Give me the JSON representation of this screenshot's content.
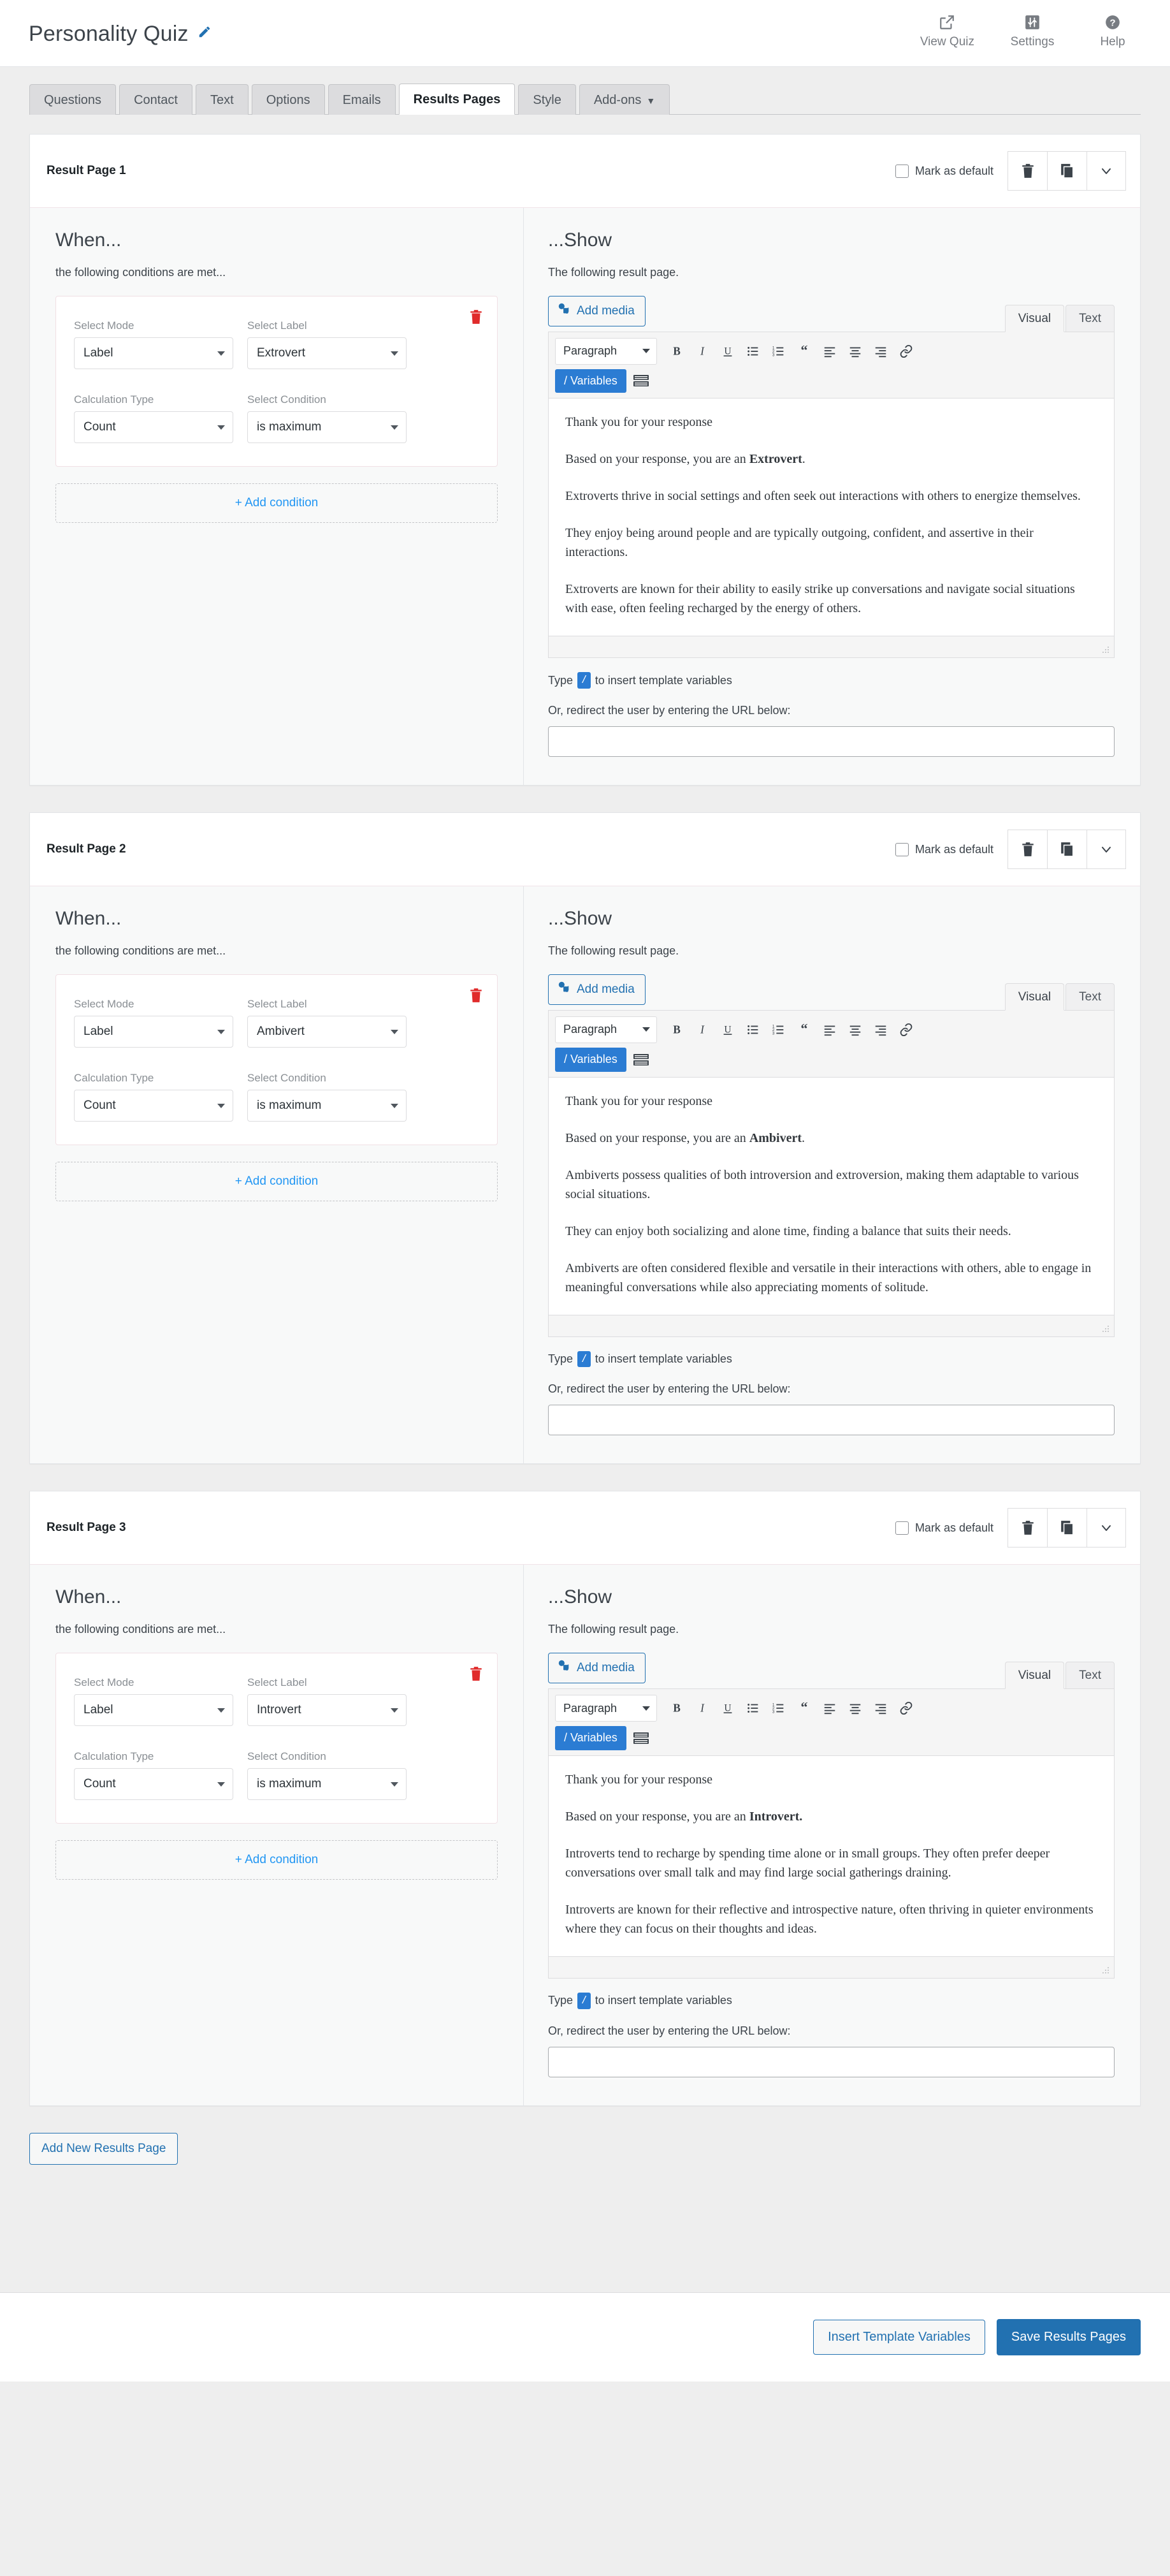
{
  "header": {
    "title": "Personality Quiz",
    "edit_icon": "pencil-icon",
    "actions": [
      {
        "label": "View Quiz",
        "icon": "external-link-icon"
      },
      {
        "label": "Settings",
        "icon": "sliders-icon"
      },
      {
        "label": "Help",
        "icon": "question-circle-icon"
      }
    ]
  },
  "tabs": [
    {
      "label": "Questions",
      "active": false
    },
    {
      "label": "Contact",
      "active": false
    },
    {
      "label": "Text",
      "active": false
    },
    {
      "label": "Options",
      "active": false
    },
    {
      "label": "Emails",
      "active": false
    },
    {
      "label": "Results Pages",
      "active": true
    },
    {
      "label": "Style",
      "active": false
    },
    {
      "label": "Add-ons",
      "active": false,
      "caret": "▼"
    }
  ],
  "common": {
    "mark_as_default": "Mark as default",
    "when_title": "When...",
    "when_sub": "the following conditions are met...",
    "show_title": "...Show",
    "show_sub": "The following result page.",
    "label_select_mode": "Select Mode",
    "label_select_label": "Select Label",
    "label_calculation_type": "Calculation Type",
    "label_select_condition": "Select Condition",
    "add_condition": "+ Add condition",
    "add_media": "Add media",
    "tab_visual": "Visual",
    "tab_text": "Text",
    "paragraph": "Paragraph",
    "variables_button": "/ Variables",
    "hint_prefix": "Type",
    "hint_key": "/",
    "hint_suffix": "to insert template variables",
    "redirect_label": "Or, redirect the user by entering the URL below:",
    "url_value": "",
    "url_placeholder": "",
    "delete_icon": "trash-icon",
    "duplicate_icon": "copy-icon",
    "collapse_icon": "chevron-down-icon",
    "delete_condition_icon": "trash-red-icon",
    "toolbar_icons": [
      "bold-icon",
      "italic-icon",
      "underline-icon",
      "bulleted-list-icon",
      "numbered-list-icon",
      "blockquote-icon",
      "align-left-icon",
      "align-center-icon",
      "align-right-icon",
      "link-icon"
    ],
    "keyboard_icon": "keyboard-icon",
    "resize_icon": "resize-grip-icon"
  },
  "pages": [
    {
      "title": "Result Page 1",
      "mark_default_checked": false,
      "condition": {
        "mode": "Label",
        "label": "Extrovert",
        "calculation": "Count",
        "condition": "is maximum"
      },
      "content": [
        {
          "text": "Thank you for your response"
        },
        {
          "pre": "Based on your response, you are an ",
          "bold": "Extrovert",
          "post": "."
        },
        {
          "text": "Extroverts thrive in social settings and often seek out interactions with others to energize themselves."
        },
        {
          "text": "They enjoy being around people and are typically outgoing, confident, and assertive in their interactions."
        },
        {
          "text": "Extroverts are known for their ability to easily strike up conversations and navigate social situations with ease, often feeling recharged by the energy of others."
        }
      ]
    },
    {
      "title": "Result Page 2",
      "mark_default_checked": false,
      "condition": {
        "mode": "Label",
        "label": "Ambivert",
        "calculation": "Count",
        "condition": "is maximum"
      },
      "content": [
        {
          "text": "Thank you for your response"
        },
        {
          "pre": "Based on your response, you are an ",
          "bold": "Ambivert",
          "post": "."
        },
        {
          "text": "Ambiverts possess qualities of both introversion and extroversion, making them adaptable to various social situations."
        },
        {
          "text": "They can enjoy both socializing and alone time, finding a balance that suits their needs."
        },
        {
          "text": "Ambiverts are often considered flexible and versatile in their interactions with others, able to engage in meaningful conversations while also appreciating moments of solitude."
        }
      ]
    },
    {
      "title": "Result Page 3",
      "mark_default_checked": false,
      "condition": {
        "mode": "Label",
        "label": "Introvert",
        "calculation": "Count",
        "condition": "is maximum"
      },
      "content": [
        {
          "text": "Thank you for your response"
        },
        {
          "pre": "Based on your response, you are an ",
          "bold": "Introvert.",
          "post": ""
        },
        {
          "text": "Introverts tend to recharge by spending time alone or in small groups. They often prefer deeper conversations over small talk and may find large social gatherings draining."
        },
        {
          "text": "Introverts are known for their reflective and introspective nature, often thriving in quieter environments where they can focus on their thoughts and ideas."
        }
      ]
    }
  ],
  "footer": {
    "add_new_results_page": "Add New Results Page",
    "insert_template_variables": "Insert Template Variables",
    "save_results_pages": "Save Results Pages"
  },
  "colors": {
    "accent": "#2271b1",
    "link": "#2196f3",
    "variables": "#2b7cd3",
    "danger": "#e02b2b",
    "page_bg": "#eeeeee"
  }
}
